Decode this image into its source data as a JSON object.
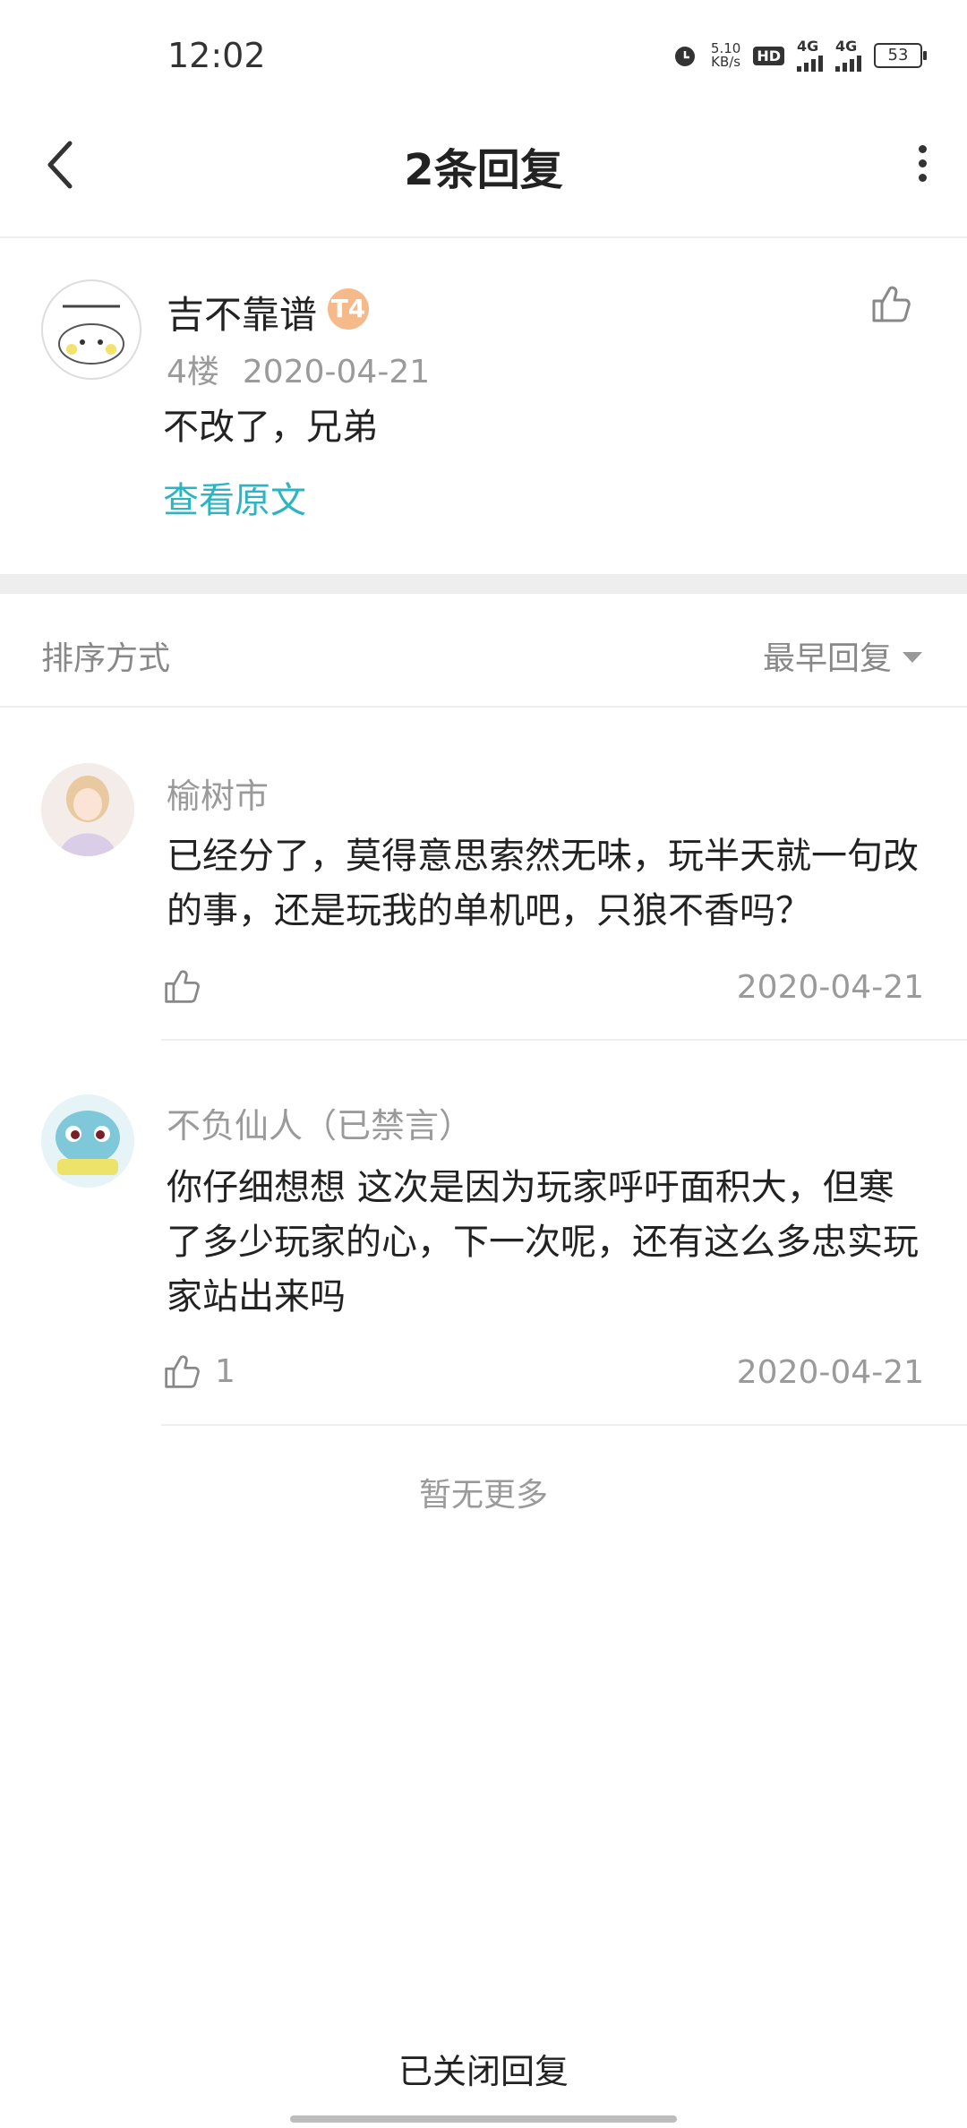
{
  "status": {
    "time": "12:02",
    "speed_value": "5.10",
    "speed_unit": "KB/s",
    "hd": "HD",
    "sim1": "4G",
    "sim2": "4G",
    "battery": "53"
  },
  "header": {
    "title": "2条回复"
  },
  "post": {
    "author": "吉不靠谱",
    "badge": "T4",
    "floor": "4楼",
    "date": "2020-04-21",
    "content": "不改了，兄弟",
    "view_original": "查看原文"
  },
  "sort": {
    "label": "排序方式",
    "value": "最早回复"
  },
  "replies": [
    {
      "author": "榆树市",
      "content": "已经分了，莫得意思索然无味，玩半天就一句改的事，还是玩我的单机吧，只狼不香吗？",
      "likes": "",
      "date": "2020-04-21"
    },
    {
      "author": "不负仙人（已禁言）",
      "content": "你仔细想想 这次是因为玩家呼吁面积大，但寒了多少玩家的心，下一次呢，还有这么多忠实玩家站出来吗",
      "likes": "1",
      "date": "2020-04-21"
    }
  ],
  "footer": {
    "no_more": "暂无更多",
    "closed": "已关闭回复"
  },
  "colors": {
    "link": "#2cb4c2",
    "muted": "#9a9a9a",
    "badge": "#f5b98a"
  }
}
